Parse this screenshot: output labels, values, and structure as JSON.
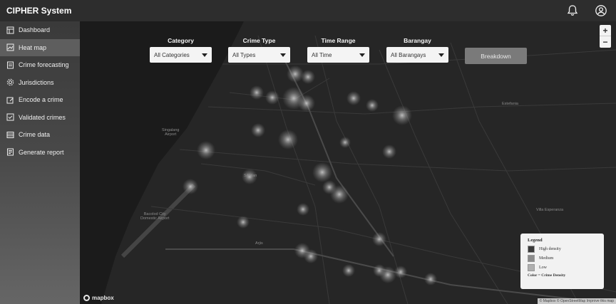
{
  "app": {
    "title": "CIPHER System"
  },
  "topbar": {
    "icons": [
      "bell-icon",
      "user-icon"
    ]
  },
  "sidebar": {
    "items": [
      {
        "label": "Dashboard",
        "icon": "dashboard-icon"
      },
      {
        "label": "Heat map",
        "icon": "map-icon",
        "active": true
      },
      {
        "label": "Crime forecasting",
        "icon": "forecast-icon"
      },
      {
        "label": "Jurisdictions",
        "icon": "gear-icon"
      },
      {
        "label": "Encode a crime",
        "icon": "edit-icon"
      },
      {
        "label": "Validated crimes",
        "icon": "checklist-icon"
      },
      {
        "label": "Crime data",
        "icon": "table-icon"
      },
      {
        "label": "Generate report",
        "icon": "report-icon"
      }
    ]
  },
  "filters": {
    "category": {
      "label": "Category",
      "value": "All Categories"
    },
    "crime_type": {
      "label": "Crime Type",
      "value": "All Types"
    },
    "time_range": {
      "label": "Time Range",
      "value": "All Time"
    },
    "barangay": {
      "label": "Barangay",
      "value": "All Barangays"
    },
    "breakdown_label": "Breakdown"
  },
  "zoom": {
    "in": "+",
    "out": "−"
  },
  "legend": {
    "title": "Legend",
    "items": [
      {
        "label": "High density",
        "color": "#3a3a3a"
      },
      {
        "label": "Medium",
        "color": "#8c8c8c"
      },
      {
        "label": "Low",
        "color": "#b0b0b0"
      }
    ],
    "note": "Color = Crime Density"
  },
  "map": {
    "logo": "mapbox",
    "attribution": "© Mapbox © OpenStreetMap  Improve this map",
    "places": [
      {
        "name": "Singalang\nAirport"
      },
      {
        "name": "Sibulan"
      },
      {
        "name": "Bacolod City\nDomestic Airport"
      },
      {
        "name": "Arjis"
      },
      {
        "name": "Estefania"
      },
      {
        "name": "Villa Esperanza"
      }
    ]
  }
}
